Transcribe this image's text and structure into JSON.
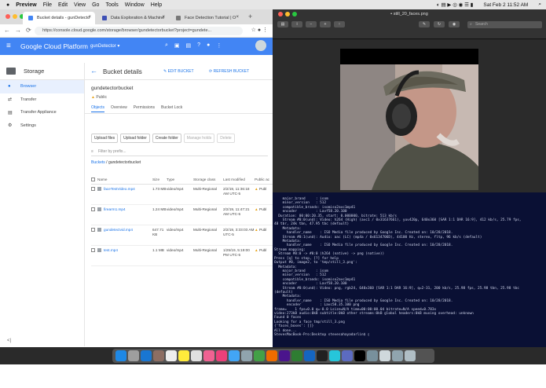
{
  "menubar": {
    "apple": "",
    "app": "Preview",
    "items": [
      "File",
      "Edit",
      "View",
      "Go",
      "Tools",
      "Window",
      "Help"
    ],
    "datetime": "Sat Feb 2 11:52 AM"
  },
  "browser": {
    "tabs": [
      {
        "label": "Bucket details - gunDetecto",
        "close": "×"
      },
      {
        "label": "Data Exploration & Machine",
        "close": "×"
      },
      {
        "label": "Face Detection Tutorial | O",
        "close": "×"
      }
    ],
    "new_tab": "+",
    "url": "https://console.cloud.google.com/storage/browser/gundetectorbucket?project=gundete...",
    "gcp": {
      "brand": "Google Cloud Platform",
      "project": "gunDetector ▾"
    },
    "sidebar": {
      "title": "Storage",
      "items": [
        {
          "icon": "●",
          "label": "Browser"
        },
        {
          "icon": "⇄",
          "label": "Transfer"
        },
        {
          "icon": "▤",
          "label": "Transfer Appliance"
        },
        {
          "icon": "⚙",
          "label": "Settings"
        }
      ],
      "collapse": "<|"
    },
    "bucket": {
      "header": "Bucket details",
      "edit": "EDIT BUCKET",
      "refresh": "REFRESH BUCKET",
      "name": "gundetectorbucket",
      "public": "Public",
      "tabs": [
        "Objects",
        "Overview",
        "Permissions",
        "Bucket Lock"
      ],
      "actions": [
        "Upload files",
        "Upload folder",
        "Create folder",
        "Manage holds",
        "Delete"
      ],
      "filter_placeholder": "Filter by prefix...",
      "breadcrumb": {
        "root": "Buckets",
        "sep": " / ",
        "current": "gundetectorbucket"
      },
      "columns": [
        "Name",
        "Size",
        "Type",
        "Storage class",
        "Last modified",
        "Public ac"
      ],
      "rows": [
        {
          "name": "faceTestVideo.mp4",
          "size": "1.73 MB",
          "type": "video/mp4",
          "class": "Multi-Regional",
          "modified": "2/2/19, 11:36:18 AM UTC-5",
          "public": "Publ"
        },
        {
          "name": "firearm1.mp4",
          "size": "1.24 MB",
          "type": "video/mp4",
          "class": "Multi-Regional",
          "modified": "2/2/19, 11:47:21 AM UTC-5",
          "public": "Publ"
        },
        {
          "name": "gundetectvid.mp4",
          "size": "647.71 KB",
          "type": "video/mp4",
          "class": "Multi-Regional",
          "modified": "2/2/19, 3:33:03 AM UTC-5",
          "public": "Publ"
        },
        {
          "name": "test.mp4",
          "size": "1.1 MB",
          "type": "video/mp4",
          "class": "Multi-Regional",
          "modified": "1/25/19, 5:19:00 PM UTC-5",
          "public": "Publ"
        }
      ]
    }
  },
  "preview": {
    "title": "still_20_faces.png",
    "search_placeholder": "Search"
  },
  "terminal": {
    "text": "    major_brand     : isom\n    minor_version   : 512\n    compatible_brands: isomiso2avc1mp41\n    encoder         : Lavf58.20.100\n  Duration: 00:00:20.35, start: 0.000000, bitrate: 513 kb/s\n    Stream #0:0(und): Video: h264 (High) (avc1 / 0x31637661), yuv420p, 640x360 [SAR 1:1 DAR 16:9], 412 kb/s, 25.79 fps,\n48 tbr, 24k tbn, 47.95 tbc (default)\n    Metadata:\n      handler_name    : ISO Media file produced by Google Inc. Created on: 10/28/2018.\n    Stream #0:1(und): Audio: aac (LC) (mp4a / 0x6134706D), 44100 Hz, stereo, fltp, 96 kb/s (default)\n    Metadata:\n      handler_name    : ISO Media file produced by Google Inc. Created on: 10/28/2018.\nStream mapping:\n  Stream #0:0 -> #0:0 (h264 (native) -> png (native))\nPress [q] to stop, [?] for help\nOutput #0, image2, to 'tmp/still_3.png':\n  Metadata:\n    major_brand     : isom\n    minor_version   : 512\n    compatible_brands: isomiso2avc1mp41\n    encoder         : Lavf58.20.100\n    Stream #0:0(und): Video: png, rgb24, 640x360 [SAR 1:1 DAR 16:9], q=2-31, 200 kb/s, 25.98 fps, 25.98 tbn, 25.98 tbc\n(default)\n    Metadata:\n      handler_name    : ISO Media file produced by Google Inc. Created on: 10/28/2018.\n      encoder         : Lavc58.35.100 png\nframe=    1 fps=0.0 q=-0.0 Lsize=N/A time=00:00:00.04 bitrate=N/A speed=0.783x\nvideo:273kB audio:0kB subtitle:0kB other streams:0kB global headers:0kB muxing overhead: unknown\nFound 0 faces\nLooking for a face tmp/still_3.png\n{'faces_boxes': []}\nAll done...\nStevesMacBook-Pro:Desktop stevesahayadarlin$ ▯"
  },
  "colors": {
    "gcp_blue": "#4285f4",
    "link": "#1a73e8",
    "terminal_bg": "#0a1034"
  }
}
